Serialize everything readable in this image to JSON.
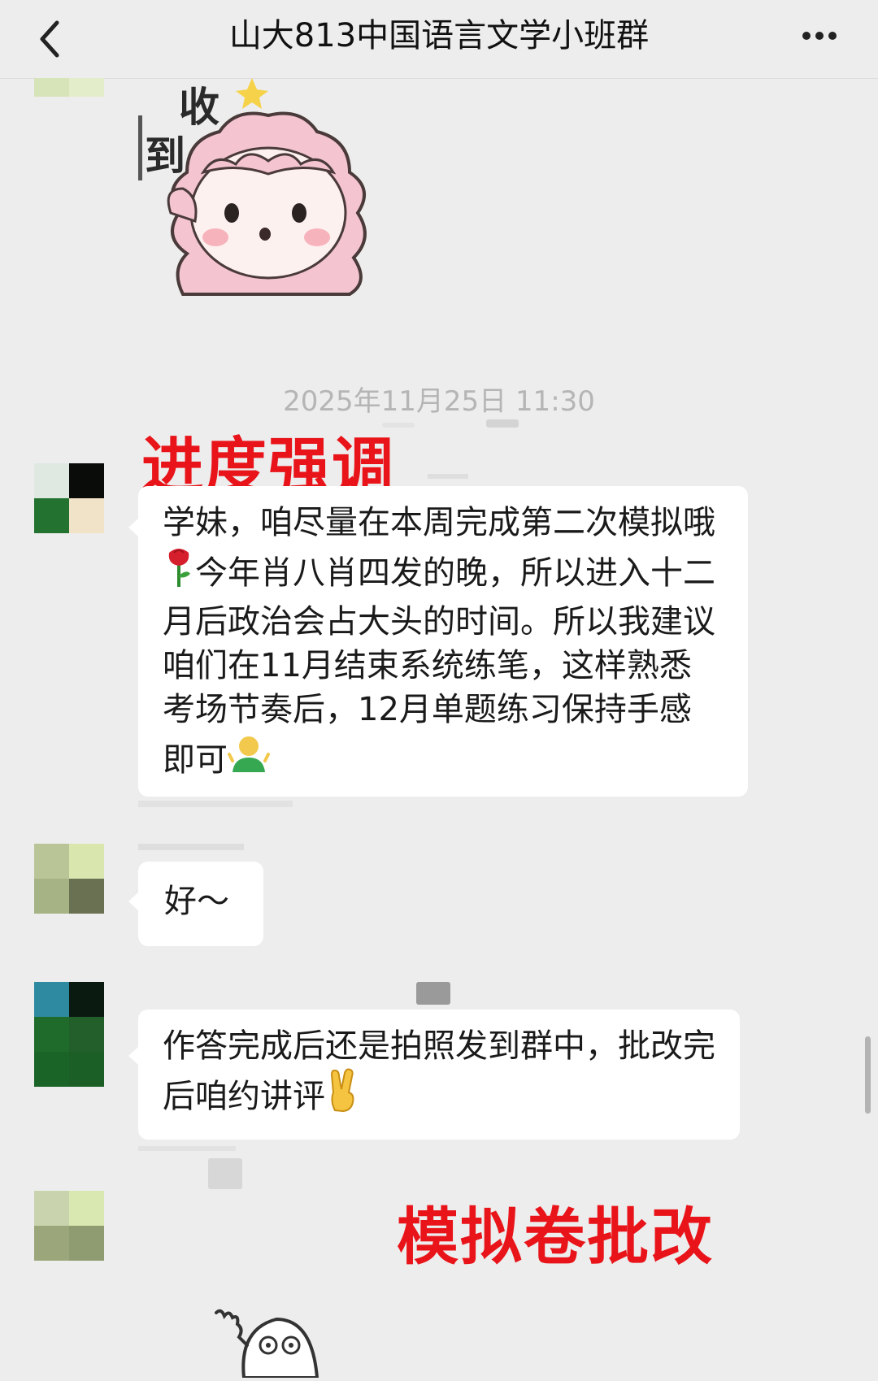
{
  "header": {
    "title": "山大813中国语言文学小班群"
  },
  "sticker_top": {
    "text1": "收",
    "text2": "到",
    "icon": "pink-sheep-sticker"
  },
  "timestamp": "2025年11月25日 11:30",
  "annotations": {
    "progress": "进度强调",
    "grading": "模拟卷批改"
  },
  "messages": [
    {
      "sender": "left",
      "text_before": "学妹，咱尽量在本周完成第二次模拟哦",
      "emoji1": "rose",
      "text_mid": "今年肖八肖四发的晚，所以进入十二月后政治会占大头的时间。所以我建议咱们在11月结束系统练笔，这样熟悉考场节奏后，12月单题练习保持手感即可",
      "emoji2": "person-shrug"
    },
    {
      "sender": "left",
      "text": "好～"
    },
    {
      "sender": "left",
      "text_before": "作答完成后还是拍照发到群中，批改完后咱约讲评",
      "emoji": "victory-hand"
    }
  ],
  "sticker_bottom": {
    "icon": "waving-ghost-sticker"
  },
  "colors": {
    "background": "#ededed",
    "bubble": "#ffffff",
    "annotation": "#e8141a"
  }
}
